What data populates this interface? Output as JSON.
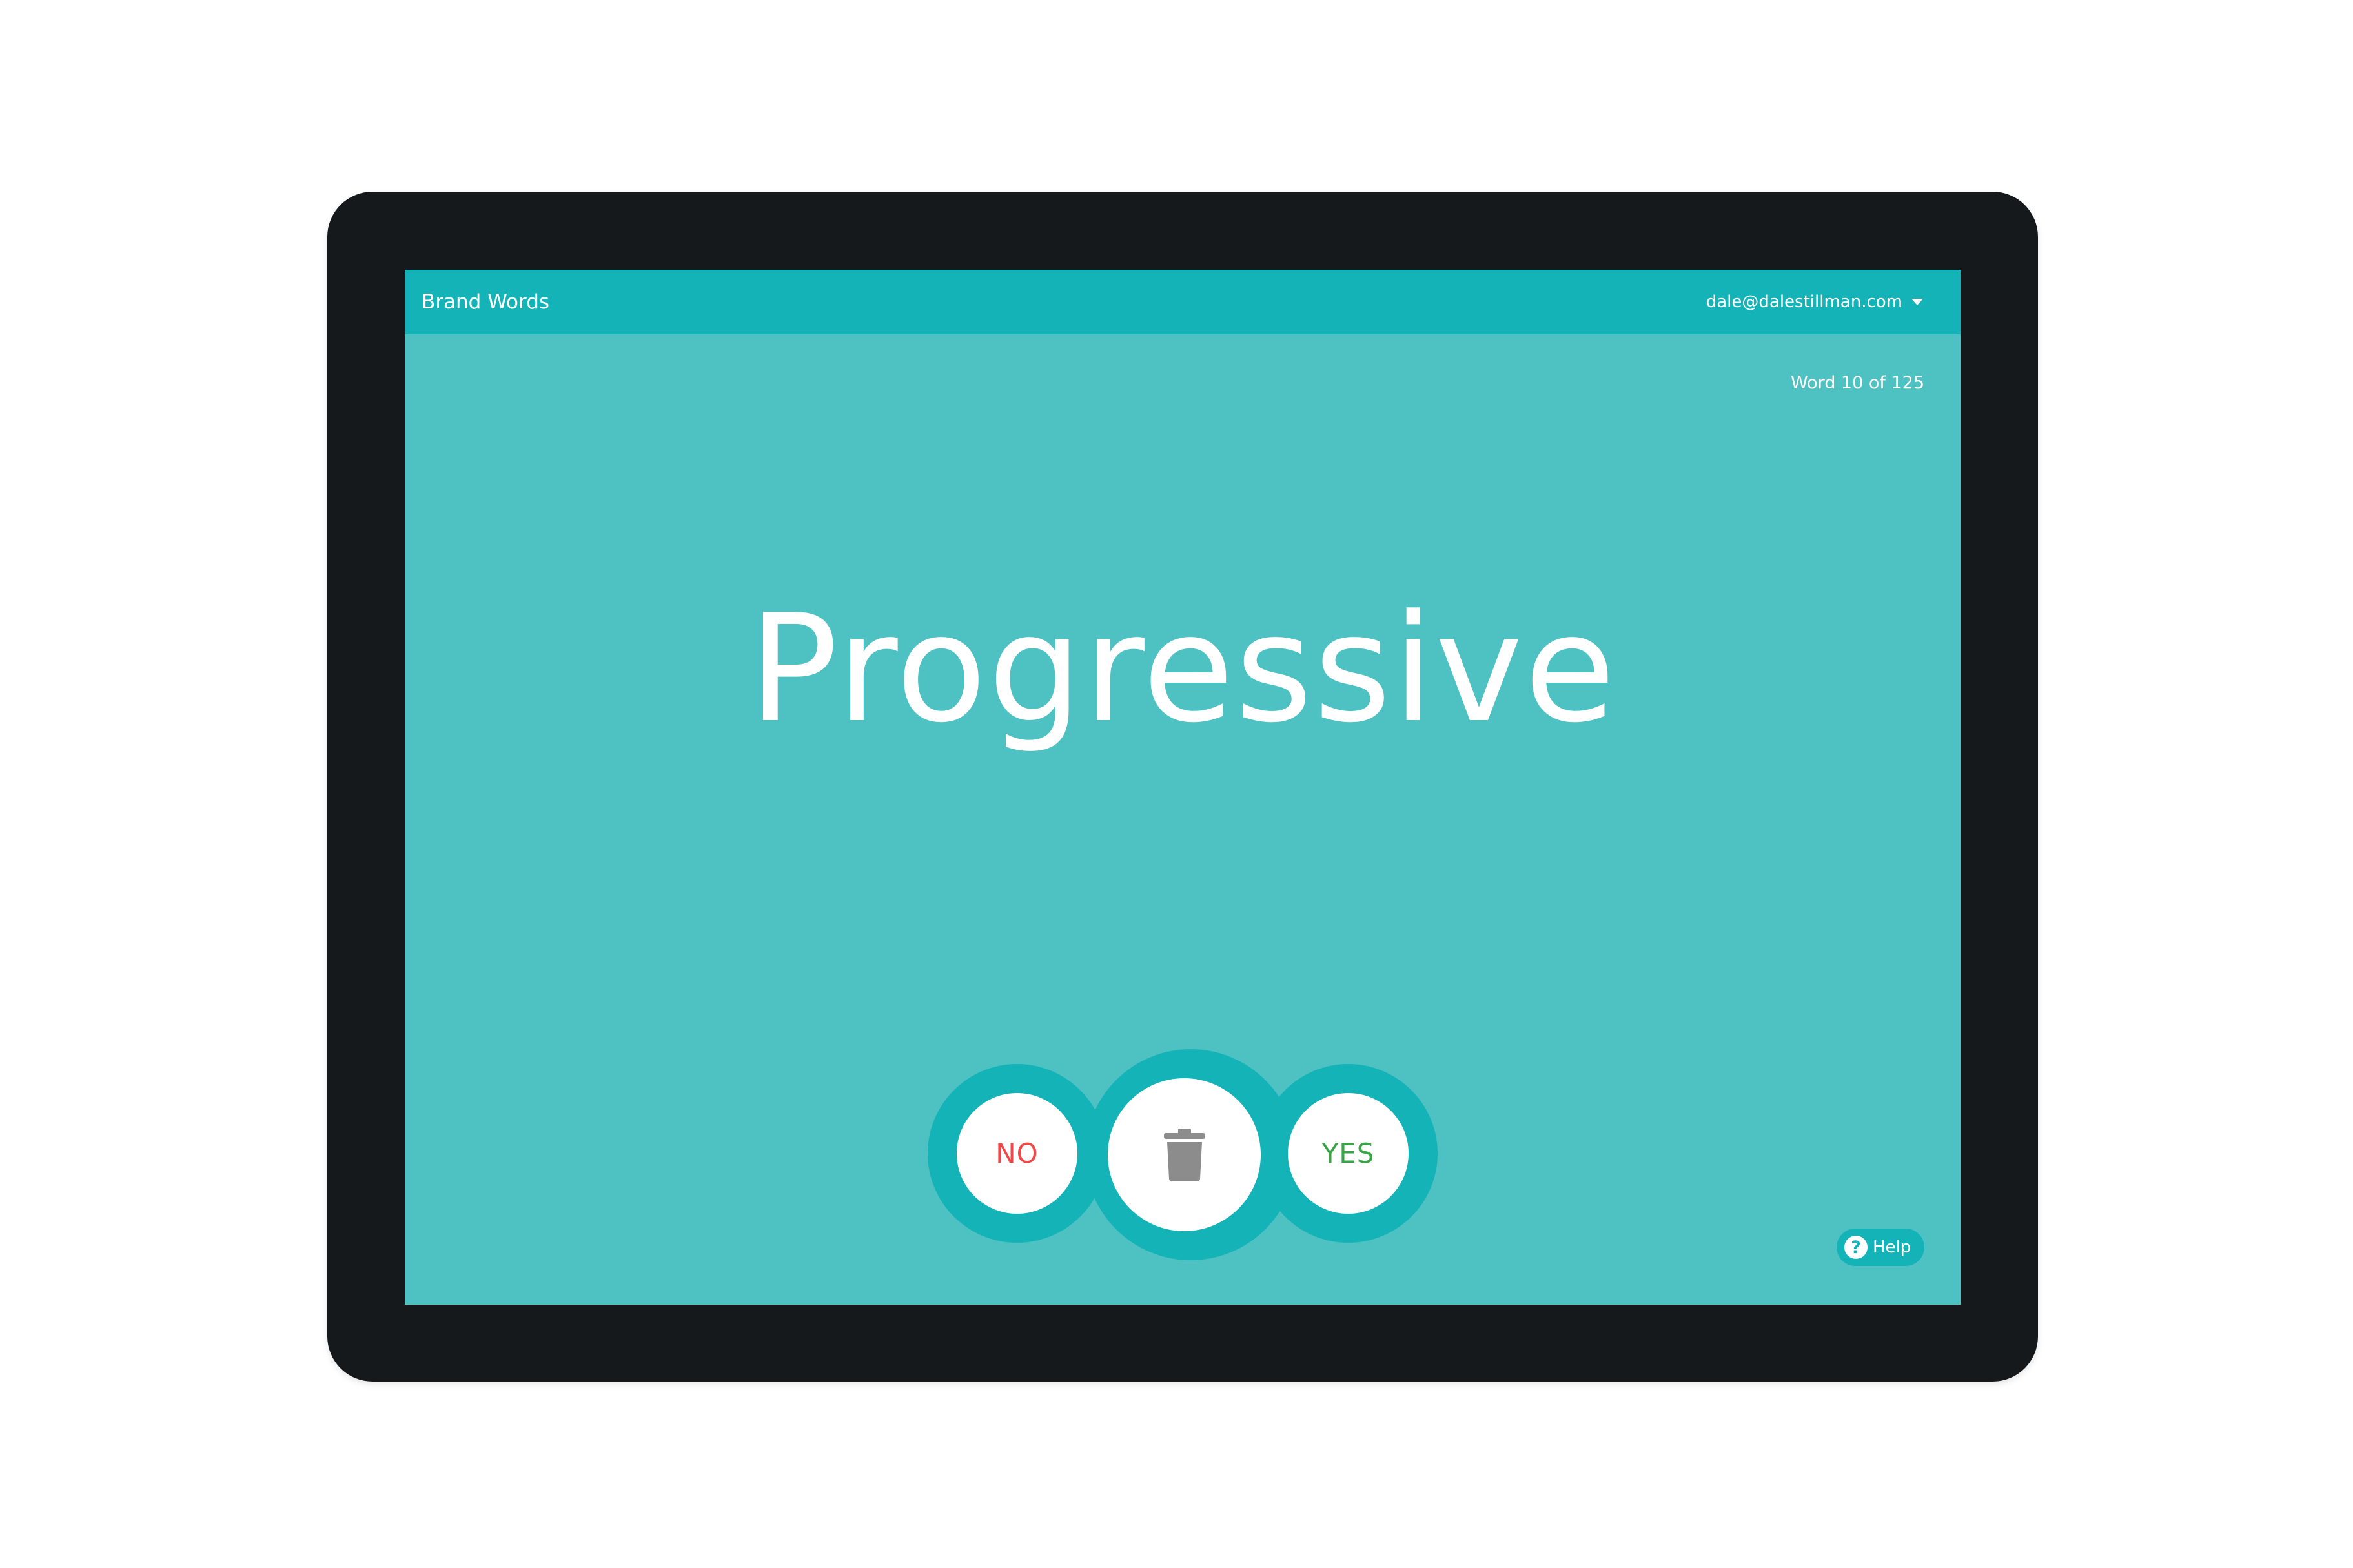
{
  "app": {
    "title": "Brand Words",
    "account_email": "dale@dalestillman.com"
  },
  "progress": {
    "label": "Word 10 of 125"
  },
  "card": {
    "word": "Progressive"
  },
  "actions": {
    "no_label": "NO",
    "yes_label": "YES",
    "delete_icon": "trash-icon"
  },
  "help": {
    "label": "Help",
    "icon": "question-mark",
    "icon_glyph": "?"
  },
  "colors": {
    "background": "#4ec1c2",
    "accent": "#14b3b8",
    "no": "#f04848",
    "yes": "#37a545",
    "icon_gray": "#8c8c8c"
  }
}
